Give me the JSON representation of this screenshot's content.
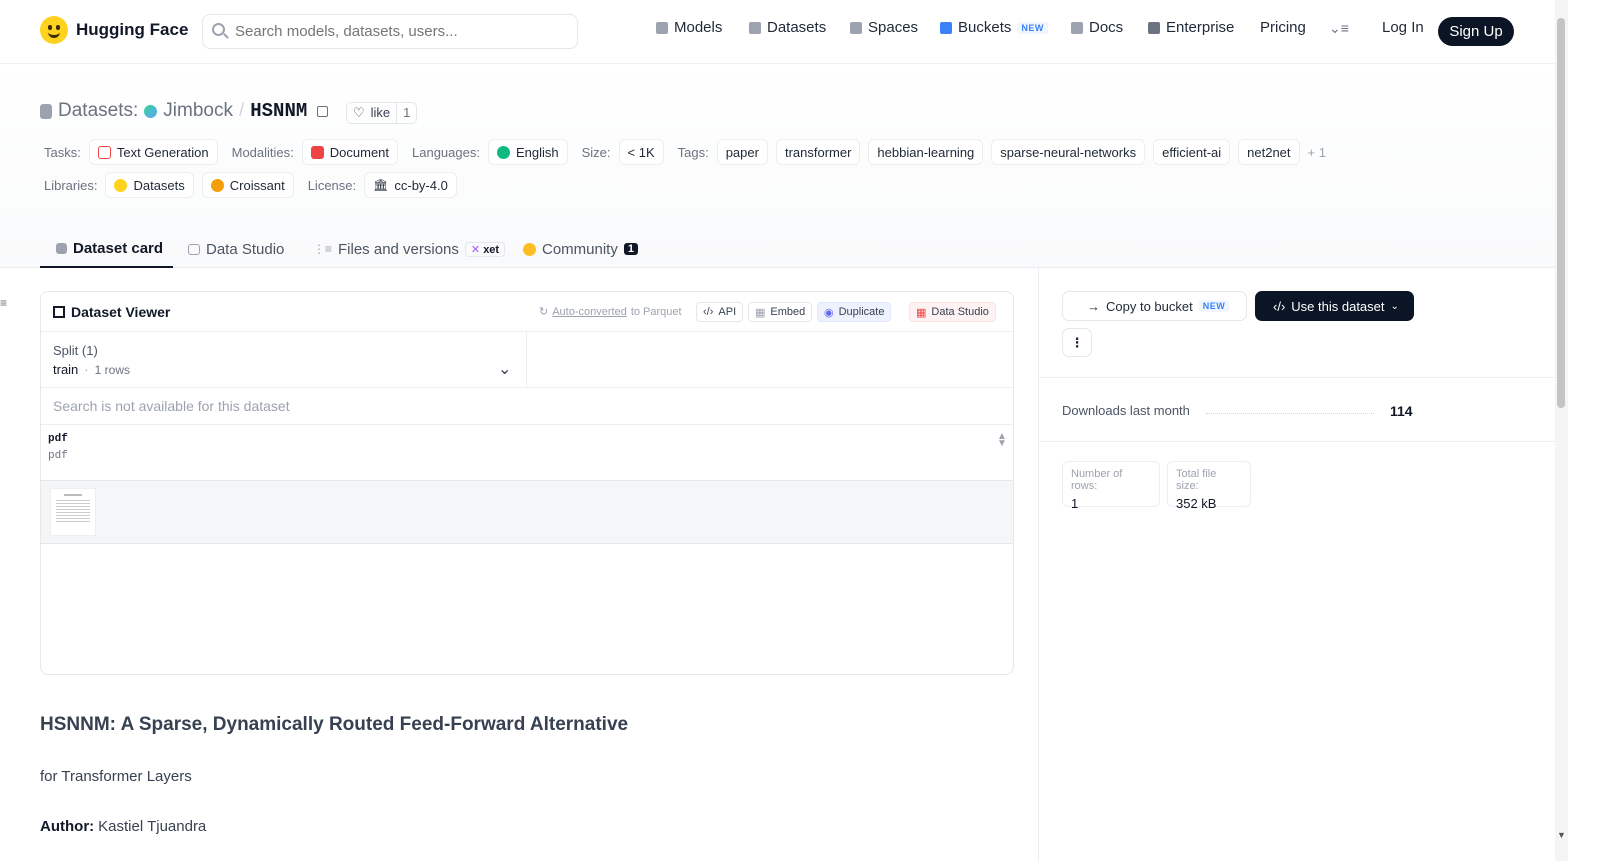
{
  "brand": {
    "name": "Hugging Face"
  },
  "search": {
    "placeholder": "Search models, datasets, users..."
  },
  "nav": {
    "models": "Models",
    "datasets": "Datasets",
    "spaces": "Spaces",
    "buckets": "Buckets",
    "buckets_badge": "NEW",
    "docs": "Docs",
    "enterprise": "Enterprise",
    "pricing": "Pricing",
    "login": "Log In",
    "signup": "Sign Up"
  },
  "repo": {
    "section": "Datasets:",
    "owner": "Jimbock",
    "separator": "/",
    "name": "HSNNM",
    "like_label": "like",
    "like_count": "1"
  },
  "meta": {
    "tasks_label": "Tasks:",
    "task": "Text Generation",
    "modalities_label": "Modalities:",
    "modality": "Document",
    "languages_label": "Languages:",
    "language": "English",
    "size_label": "Size:",
    "size": "< 1K",
    "tags_label": "Tags:",
    "tags": [
      "paper",
      "transformer",
      "hebbian-learning",
      "sparse-neural-networks",
      "efficient-ai",
      "net2net"
    ],
    "tags_more": "+ 1",
    "libraries_label": "Libraries:",
    "libraries": [
      "Datasets",
      "Croissant"
    ],
    "license_label": "License:",
    "license": "cc-by-4.0"
  },
  "tabs": {
    "card": "Dataset card",
    "studio": "Data Studio",
    "files": "Files and versions",
    "files_badge": "xet",
    "community": "Community",
    "community_count": "1"
  },
  "viewer": {
    "title": "Dataset Viewer",
    "auto_converted": "Auto-converted",
    "to_parquet": "to Parquet",
    "api": "API",
    "embed": "Embed",
    "duplicate": "Duplicate",
    "data_studio": "Data Studio",
    "split_label": "Split (1)",
    "split_value": "train",
    "split_dot": "·",
    "split_rows": "1 rows",
    "search_disabled": "Search is not available for this dataset",
    "column_name": "pdf",
    "column_type": "pdf"
  },
  "card": {
    "heading": "HSNNM: A Sparse, Dynamically Routed Feed-Forward Alternative",
    "subheading": "for Transformer Layers",
    "author_label": "Author:",
    "author": "Kastiel Tjuandra"
  },
  "sidebar": {
    "copy_bucket": "Copy to bucket",
    "copy_badge": "NEW",
    "use_dataset": "Use this dataset",
    "downloads_label": "Downloads last month",
    "downloads_value": "114",
    "rows_label": "Number of rows:",
    "rows_value": "1",
    "filesize_label": "Total file size:",
    "filesize_value": "352 kB"
  },
  "colors": {
    "accent_dark": "#0b1526",
    "link": "#3b82f6",
    "brand_yellow": "#ffd21e"
  }
}
